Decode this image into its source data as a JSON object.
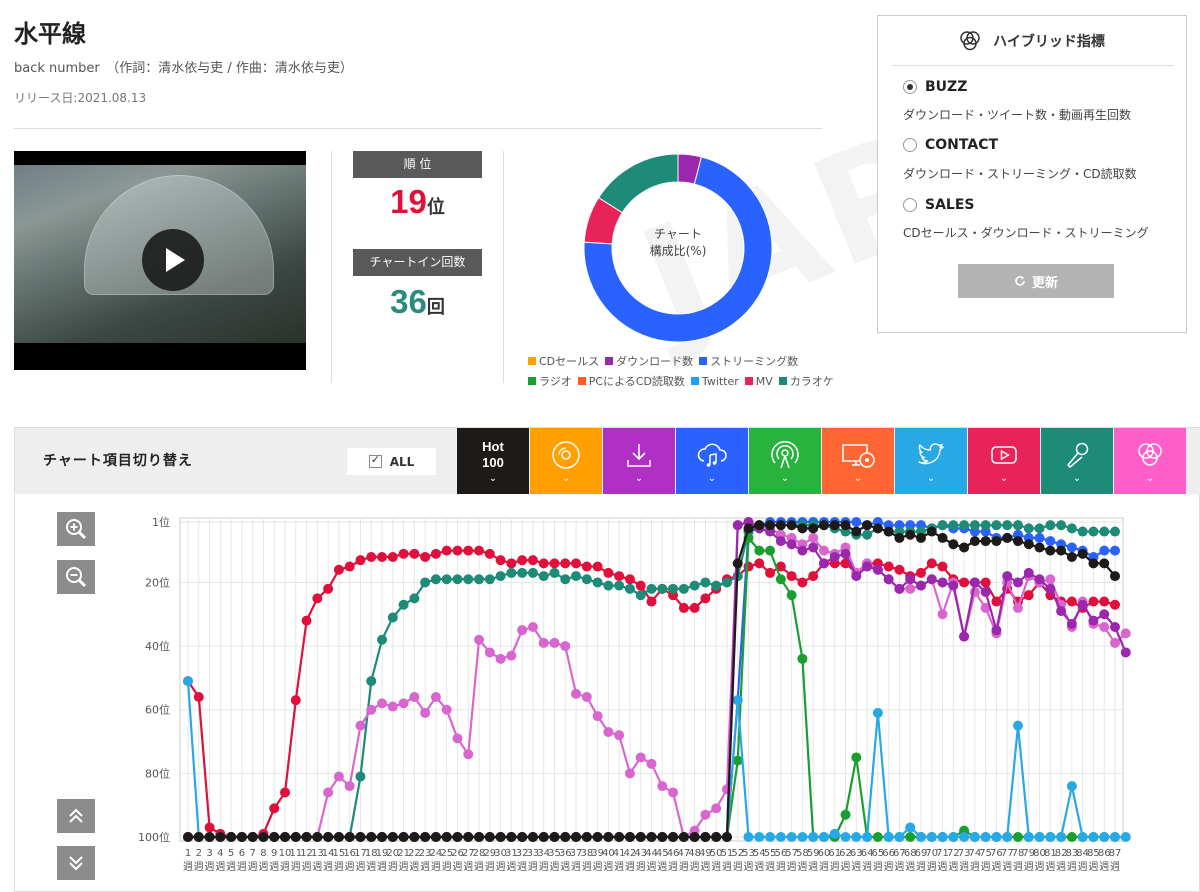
{
  "song": {
    "title": "水平線",
    "artist": "back number　（作詞：清水依与吏 / 作曲：清水依与吏）",
    "release": "リリース日:2021.08.13"
  },
  "watermark": "JAPAN",
  "stats": {
    "rank_label": "順 位",
    "rank_value": "19",
    "rank_unit": "位",
    "rank_color": "#e0103a",
    "chartin_label": "チャートイン回数",
    "chartin_value": "36",
    "chartin_unit": "回",
    "chartin_color": "#2a8c7e"
  },
  "composition": {
    "center_line1": "チャート",
    "center_line2": "構成比(%)",
    "slices": [
      {
        "name": "ダウンロード数",
        "value": 4,
        "color": "#9b27af"
      },
      {
        "name": "ストリーミング数",
        "value": 72,
        "color": "#2962ff"
      },
      {
        "name": "MV",
        "value": 8,
        "color": "#e8235a"
      },
      {
        "name": "カラオケ",
        "value": 16,
        "color": "#1e8a78"
      }
    ],
    "legend": [
      {
        "name": "CDセールス",
        "color": "#ffa000"
      },
      {
        "name": "ダウンロード数",
        "color": "#9b27af"
      },
      {
        "name": "ストリーミング数",
        "color": "#2962ff"
      },
      {
        "name": "ラジオ",
        "color": "#1a9e2f"
      },
      {
        "name": "PCによるCD読取数",
        "color": "#ff5a1f"
      },
      {
        "name": "Twitter",
        "color": "#1da1f2"
      },
      {
        "name": "MV",
        "color": "#e8235a"
      },
      {
        "name": "カラオケ",
        "color": "#1e8a78"
      }
    ]
  },
  "hybrid": {
    "title": "ハイブリッド指標",
    "options": [
      {
        "label": "BUZZ",
        "desc": "ダウンロード・ツイート数・動画再生回数",
        "selected": true
      },
      {
        "label": "CONTACT",
        "desc": "ダウンロード・ストリーミング・CD読取数",
        "selected": false
      },
      {
        "label": "SALES",
        "desc": "CDセールス・ダウンロード・ストリーミング",
        "selected": false
      }
    ],
    "update_label": "更新"
  },
  "switcher": {
    "title": "チャート項目切り替え",
    "all_label": "ALL",
    "hot_line1": "Hot",
    "hot_line2": "100",
    "tiles": [
      {
        "name": "hot100",
        "color": "#1e1a18"
      },
      {
        "name": "cd-sales",
        "color": "#ffa000"
      },
      {
        "name": "download",
        "color": "#b02fc4"
      },
      {
        "name": "streaming",
        "color": "#2962ff"
      },
      {
        "name": "radio",
        "color": "#27b33d"
      },
      {
        "name": "pc-cd-read",
        "color": "#ff6633"
      },
      {
        "name": "twitter",
        "color": "#29a8e6"
      },
      {
        "name": "mv",
        "color": "#e8235a"
      },
      {
        "name": "karaoke",
        "color": "#1e8a78"
      },
      {
        "name": "hybrid",
        "color": "#ff5ecb"
      }
    ]
  },
  "chart_data": {
    "type": "line",
    "y_reversed": true,
    "ylim": [
      1,
      100
    ],
    "yticks": [
      "1位",
      "20位",
      "40位",
      "60位",
      "80位",
      "100位"
    ],
    "ytick_values": [
      1,
      20,
      40,
      60,
      80,
      100
    ],
    "x_label_suffix": "週",
    "x_count": 87,
    "grid": true,
    "series": [
      {
        "color": "#e0103a",
        "values": [
          51,
          56,
          97,
          99,
          100,
          100,
          100,
          99,
          91,
          86,
          57,
          32,
          25,
          22,
          16,
          15,
          13,
          12,
          12,
          12,
          11,
          11,
          12,
          11,
          10,
          10,
          10,
          10,
          11,
          13,
          14,
          13,
          13,
          14,
          14,
          14,
          14,
          15,
          15,
          17,
          18,
          19,
          21,
          26,
          22,
          24,
          28,
          28,
          25,
          22,
          19,
          18,
          15,
          14,
          17,
          15,
          18,
          20,
          18,
          14,
          14,
          14,
          17,
          14,
          14,
          15,
          16,
          18,
          17,
          14,
          15,
          19,
          20,
          20,
          20,
          26,
          22,
          26,
          24,
          20,
          24,
          26,
          26,
          28,
          26,
          26,
          27
        ]
      },
      {
        "color": "#2962ff",
        "values": [
          100,
          100,
          100,
          100,
          100,
          100,
          100,
          100,
          100,
          100,
          100,
          100,
          100,
          100,
          100,
          100,
          100,
          100,
          100,
          100,
          100,
          100,
          100,
          100,
          100,
          100,
          100,
          100,
          100,
          100,
          100,
          100,
          100,
          100,
          100,
          100,
          100,
          100,
          100,
          100,
          100,
          100,
          100,
          100,
          100,
          100,
          100,
          100,
          100,
          100,
          100,
          57,
          4,
          2,
          1,
          1,
          1,
          1,
          1,
          1,
          1,
          1,
          1,
          2,
          1,
          2,
          2,
          2,
          2,
          3,
          2,
          3,
          3,
          4,
          4,
          6,
          6,
          5,
          6,
          6,
          7,
          8,
          9,
          10,
          12,
          10,
          10
        ]
      },
      {
        "color": "#1e8a78",
        "values": [
          100,
          100,
          100,
          100,
          100,
          100,
          100,
          100,
          100,
          100,
          100,
          100,
          100,
          100,
          100,
          100,
          81,
          51,
          38,
          31,
          27,
          25,
          20,
          19,
          19,
          19,
          19,
          19,
          19,
          18,
          17,
          17,
          17,
          18,
          17,
          19,
          18,
          19,
          20,
          21,
          21,
          22,
          24,
          22,
          22,
          22,
          22,
          21,
          20,
          21,
          20,
          18,
          4,
          3,
          2,
          2,
          2,
          2,
          2,
          2,
          3,
          4,
          5,
          5,
          3,
          4,
          4,
          4,
          4,
          3,
          2,
          2,
          2,
          2,
          2,
          2,
          2,
          2,
          3,
          3,
          2,
          2,
          3,
          4,
          4,
          4,
          4
        ]
      },
      {
        "color": "#1a9e2f",
        "values": [
          100,
          100,
          100,
          100,
          100,
          100,
          100,
          100,
          100,
          100,
          100,
          100,
          100,
          100,
          100,
          100,
          100,
          100,
          100,
          100,
          100,
          100,
          100,
          100,
          100,
          100,
          100,
          100,
          100,
          100,
          100,
          100,
          100,
          100,
          100,
          100,
          100,
          100,
          100,
          100,
          100,
          100,
          100,
          100,
          100,
          100,
          100,
          100,
          100,
          100,
          100,
          76,
          6,
          10,
          10,
          19,
          24,
          44,
          100,
          100,
          100,
          93,
          75,
          100,
          100,
          100,
          100,
          100,
          100,
          100,
          100,
          100,
          98,
          100,
          100,
          100,
          100,
          100,
          100,
          100,
          100,
          100,
          100,
          100,
          100,
          100,
          100
        ]
      },
      {
        "color": "#29a8e6",
        "values": [
          51,
          100,
          100,
          100,
          100,
          100,
          100,
          100,
          100,
          100,
          100,
          100,
          100,
          100,
          100,
          100,
          100,
          100,
          100,
          100,
          100,
          100,
          100,
          100,
          100,
          100,
          100,
          100,
          100,
          100,
          100,
          100,
          100,
          100,
          100,
          100,
          100,
          100,
          100,
          100,
          100,
          100,
          100,
          100,
          100,
          100,
          100,
          100,
          100,
          100,
          100,
          57,
          100,
          100,
          100,
          100,
          100,
          100,
          100,
          100,
          99,
          100,
          100,
          100,
          61,
          100,
          100,
          97,
          100,
          100,
          100,
          100,
          100,
          100,
          100,
          100,
          100,
          65,
          100,
          100,
          100,
          100,
          84,
          100,
          100,
          100,
          100,
          100
        ]
      },
      {
        "color": "#d966cf",
        "values": [
          100,
          100,
          100,
          100,
          100,
          100,
          100,
          100,
          100,
          100,
          100,
          100,
          100,
          86,
          81,
          84,
          65,
          60,
          58,
          59,
          58,
          56,
          61,
          56,
          60,
          69,
          74,
          38,
          42,
          44,
          43,
          35,
          34,
          39,
          39,
          40,
          55,
          56,
          62,
          67,
          68,
          80,
          75,
          77,
          84,
          86,
          100,
          98,
          93,
          91,
          85,
          2,
          1,
          2,
          3,
          5,
          6,
          8,
          6,
          10,
          11,
          9,
          17,
          14,
          16,
          19,
          22,
          22,
          21,
          19,
          30,
          20,
          37,
          23,
          28,
          36,
          20,
          28,
          18,
          20,
          19,
          27,
          34,
          26,
          33,
          34,
          39,
          36
        ]
      },
      {
        "color": "#9b27af",
        "values": [
          100,
          100,
          100,
          100,
          100,
          100,
          100,
          100,
          100,
          100,
          100,
          100,
          100,
          100,
          100,
          100,
          100,
          100,
          100,
          100,
          100,
          100,
          100,
          100,
          100,
          100,
          100,
          100,
          100,
          100,
          100,
          100,
          100,
          100,
          100,
          100,
          100,
          100,
          100,
          100,
          100,
          100,
          100,
          100,
          100,
          100,
          100,
          100,
          100,
          100,
          100,
          2,
          1,
          3,
          4,
          7,
          8,
          10,
          9,
          14,
          12,
          11,
          18,
          15,
          16,
          19,
          22,
          19,
          21,
          19,
          20,
          21,
          37,
          20,
          23,
          35,
          18,
          20,
          17,
          19,
          22,
          29,
          33,
          27,
          32,
          30,
          34,
          42
        ]
      },
      {
        "color": "#1e1a18",
        "values": [
          100,
          100,
          100,
          100,
          100,
          100,
          100,
          100,
          100,
          100,
          100,
          100,
          100,
          100,
          100,
          100,
          100,
          100,
          100,
          100,
          100,
          100,
          100,
          100,
          100,
          100,
          100,
          100,
          100,
          100,
          100,
          100,
          100,
          100,
          100,
          100,
          100,
          100,
          100,
          100,
          100,
          100,
          100,
          100,
          100,
          100,
          100,
          100,
          100,
          100,
          100,
          14,
          3,
          2,
          2,
          2,
          2,
          3,
          3,
          2,
          2,
          2,
          4,
          2,
          3,
          4,
          6,
          5,
          6,
          4,
          6,
          8,
          9,
          7,
          7,
          7,
          6,
          7,
          8,
          9,
          10,
          10,
          12,
          11,
          14,
          14,
          18
        ]
      }
    ]
  }
}
